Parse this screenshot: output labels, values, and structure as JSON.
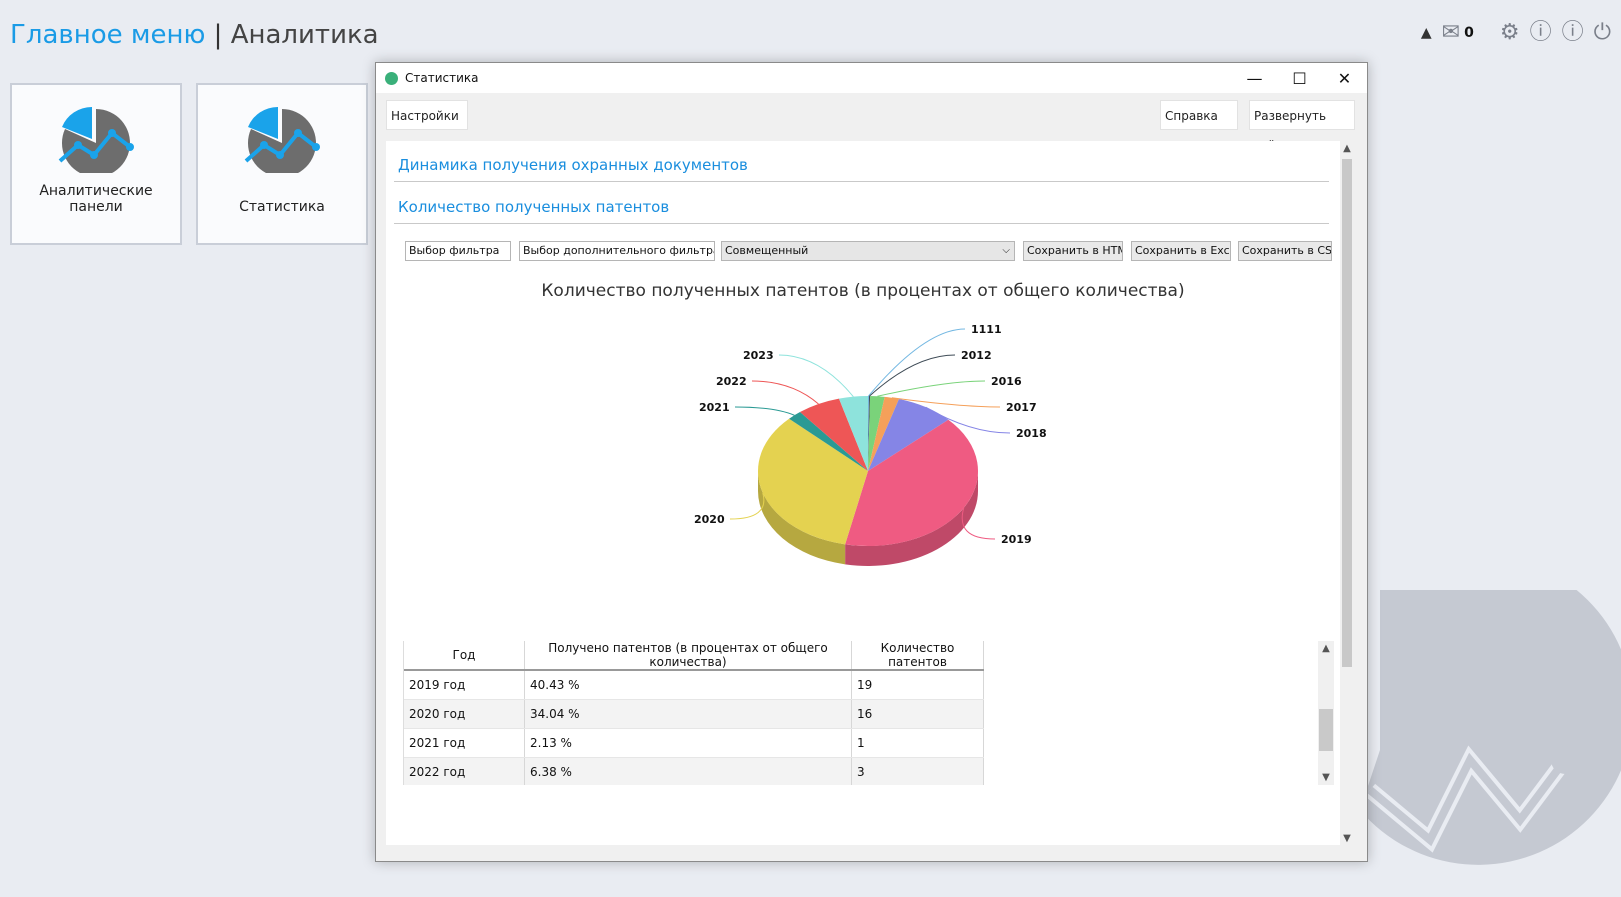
{
  "header": {
    "home": "Главное меню",
    "separator": "|",
    "section": "Аналитика",
    "mail_count": "0"
  },
  "tiles": [
    {
      "label": "Аналитические панели"
    },
    {
      "label": "Статистика"
    }
  ],
  "window": {
    "title": "Статистика",
    "toolbar": {
      "settings": "Настройки",
      "help": "Справка",
      "expand_all": "Развернуть всё"
    },
    "sections": [
      "Динамика получения охранных документов",
      "Количество полученных патентов"
    ],
    "controls": {
      "filter": "Выбор фильтра",
      "extra_filter": "Выбор дополнительного фильтра",
      "mode_selected": "Совмещенный",
      "save_html": "Сохранить в HTML",
      "save_excel": "Сохранить в Excel",
      "save_csv": "Сохранить в CSV"
    },
    "table": {
      "columns": [
        "Год",
        "Получено патентов (в процентах от общего количества)",
        "Количество патентов"
      ],
      "rows": [
        [
          "2019 год",
          "40.43 %",
          "19"
        ],
        [
          "2020 год",
          "34.04 %",
          "16"
        ],
        [
          "2021 год",
          "2.13 %",
          "1"
        ],
        [
          "2022 год",
          "6.38 %",
          "3"
        ]
      ]
    }
  },
  "chart_data": {
    "type": "pie",
    "title": "Количество полученных патентов (в процентах от общего количества)",
    "categories": [
      "1111",
      "2012",
      "2016",
      "2017",
      "2018",
      "2019",
      "2020",
      "2021",
      "2022",
      "2023"
    ],
    "values": [
      0.15,
      0.15,
      2.13,
      2.13,
      8.51,
      40.43,
      34.04,
      2.13,
      6.38,
      4.26
    ],
    "colors": [
      "#74b8e2",
      "#3d4a55",
      "#7ad37a",
      "#f5a05a",
      "#8585e6",
      "#ef5b82",
      "#e4d250",
      "#2a9a94",
      "#ee5656",
      "#8ee3dc"
    ],
    "style": "3d"
  }
}
